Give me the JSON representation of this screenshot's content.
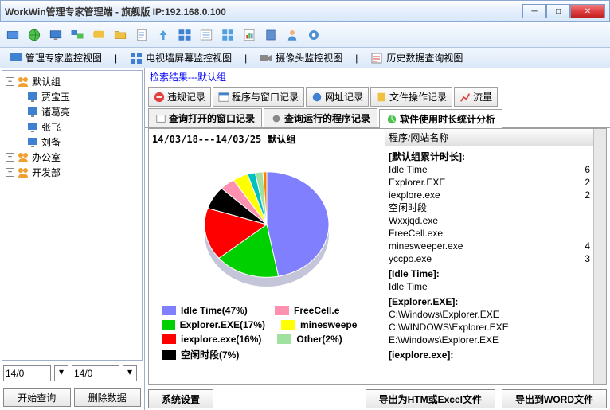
{
  "window": {
    "title": "WorkWin管理专家管理端 - 旗舰版 IP:192.168.0.100"
  },
  "viewtabs": {
    "v1": "管理专家监控视图",
    "v2": "电视墙屏幕监控视图",
    "v3": "摄像头监控视图",
    "v4": "历史数据查询视图"
  },
  "tree": {
    "g1": "默认组",
    "u1": "贾宝玉",
    "u2": "诸葛亮",
    "u3": "张飞",
    "u4": "刘备",
    "g2": "办公室",
    "g3": "开发部"
  },
  "dates": {
    "from": "14/0",
    "to": "14/0"
  },
  "leftbtns": {
    "query": "开始查询",
    "del": "删除数据"
  },
  "search_result": "检索结果---默认组",
  "tabs": {
    "t1": "违规记录",
    "t2": "程序与窗口记录",
    "t3": "网址记录",
    "t4": "文件操作记录",
    "t5": "流量"
  },
  "subtabs": {
    "s1": "查询打开的窗口记录",
    "s2": "查询运行的程序记录",
    "s3": "软件使用时长统计分析"
  },
  "chart_title": "14/03/18---14/03/25  默认组",
  "list_header": "程序/网站名称",
  "list": {
    "sec1": "[默认组累计时长]:",
    "i1": {
      "n": "Idle Time",
      "v": "6"
    },
    "i2": {
      "n": "Explorer.EXE",
      "v": "2"
    },
    "i3": {
      "n": "iexplore.exe",
      "v": "2"
    },
    "i4": {
      "n": "空闲时段",
      "v": ""
    },
    "i5": {
      "n": "Wxxjqd.exe",
      "v": ""
    },
    "i6": {
      "n": "FreeCell.exe",
      "v": ""
    },
    "i7": {
      "n": "minesweeper.exe",
      "v": "4"
    },
    "i8": {
      "n": "yccpo.exe",
      "v": "3"
    },
    "sec2": "[Idle Time]:",
    "i9": {
      "n": "Idle Time",
      "v": ""
    },
    "sec3": "[Explorer.EXE]:",
    "i10": {
      "n": "C:\\Windows\\Explorer.EXE",
      "v": ""
    },
    "i11": {
      "n": "C:\\WINDOWS\\Explorer.EXE",
      "v": ""
    },
    "i12": {
      "n": "E:\\Windows\\Explorer.EXE",
      "v": ""
    },
    "sec4": "[iexplore.exe]:"
  },
  "legend": {
    "l1": "Idle Time(47%)",
    "l2": "Explorer.EXE(17%)",
    "l3": "iexplore.exe(16%)",
    "l4": "空闲时段(7%)",
    "l5": "FreeCell.e",
    "l6": "minesweepe",
    "l7": "Other(2%)"
  },
  "bottom": {
    "b1": "系统设置",
    "b2": "导出为HTM或Excel文件",
    "b3": "导出到WORD文件"
  },
  "chart_data": {
    "type": "pie",
    "title": "14/03/18---14/03/25 默认组",
    "series": [
      {
        "name": "Idle Time",
        "value": 47,
        "color": "#8080ff"
      },
      {
        "name": "Explorer.EXE",
        "value": 17,
        "color": "#00d000"
      },
      {
        "name": "iexplore.exe",
        "value": 16,
        "color": "#ff0000"
      },
      {
        "name": "空闲时段",
        "value": 7,
        "color": "#000000"
      },
      {
        "name": "FreeCell.exe",
        "value": 4,
        "color": "#ff90b0"
      },
      {
        "name": "minesweeper.exe",
        "value": 4,
        "color": "#ffff00"
      },
      {
        "name": "Wxxjqd.exe",
        "value": 2,
        "color": "#00c0c0"
      },
      {
        "name": "Other",
        "value": 2,
        "color": "#a0e0a0"
      },
      {
        "name": "yccpo.exe",
        "value": 1,
        "color": "#ff8000"
      }
    ]
  }
}
